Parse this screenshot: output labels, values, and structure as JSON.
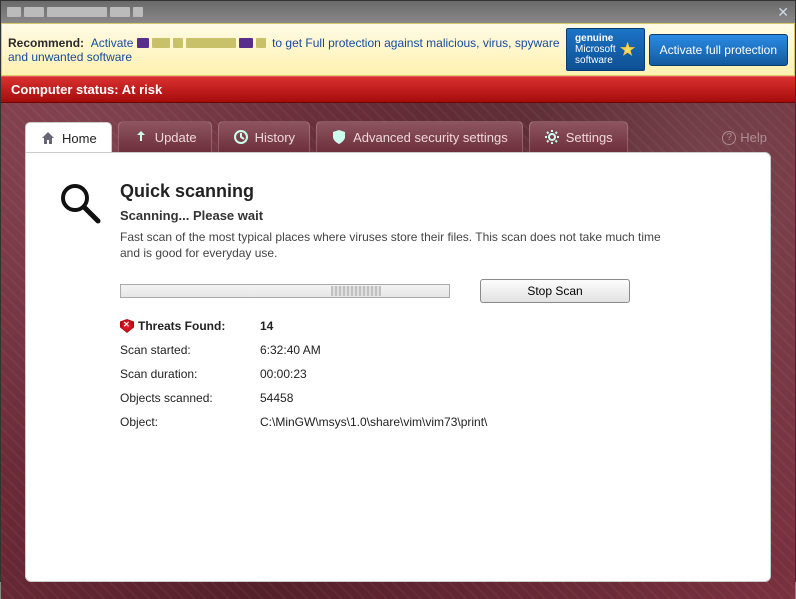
{
  "titlebar": {
    "title": ""
  },
  "recommend": {
    "label": "Recommend:",
    "prefix": "Activate",
    "suffix": "to get Full protection against malicious, virus, spyware and unwanted software",
    "genuine_line1": "genuine",
    "genuine_line2": "Microsoft",
    "genuine_line3": "software",
    "activate_btn": "Activate full protection"
  },
  "status": {
    "label": "Computer status:",
    "value": "At risk"
  },
  "tabs": {
    "home": "Home",
    "update": "Update",
    "history": "History",
    "advanced": "Advanced security settings",
    "settings": "Settings",
    "help": "Help"
  },
  "scan": {
    "title": "Quick scanning",
    "subtitle": "Scanning... Please wait",
    "description": "Fast scan of the most typical places where viruses store their files. This scan does not take much time and is good for everyday use.",
    "stop_btn": "Stop Scan"
  },
  "results": {
    "threats_label": "Threats Found:",
    "threats_value": "14",
    "started_label": "Scan started:",
    "started_value": "6:32:40 AM",
    "duration_label": "Scan duration:",
    "duration_value": "00:00:23",
    "objects_label": "Objects scanned:",
    "objects_value": "54458",
    "object_label": "Object:",
    "object_value": "C:\\MinGW\\msys\\1.0\\share\\vim\\vim73\\print\\"
  }
}
